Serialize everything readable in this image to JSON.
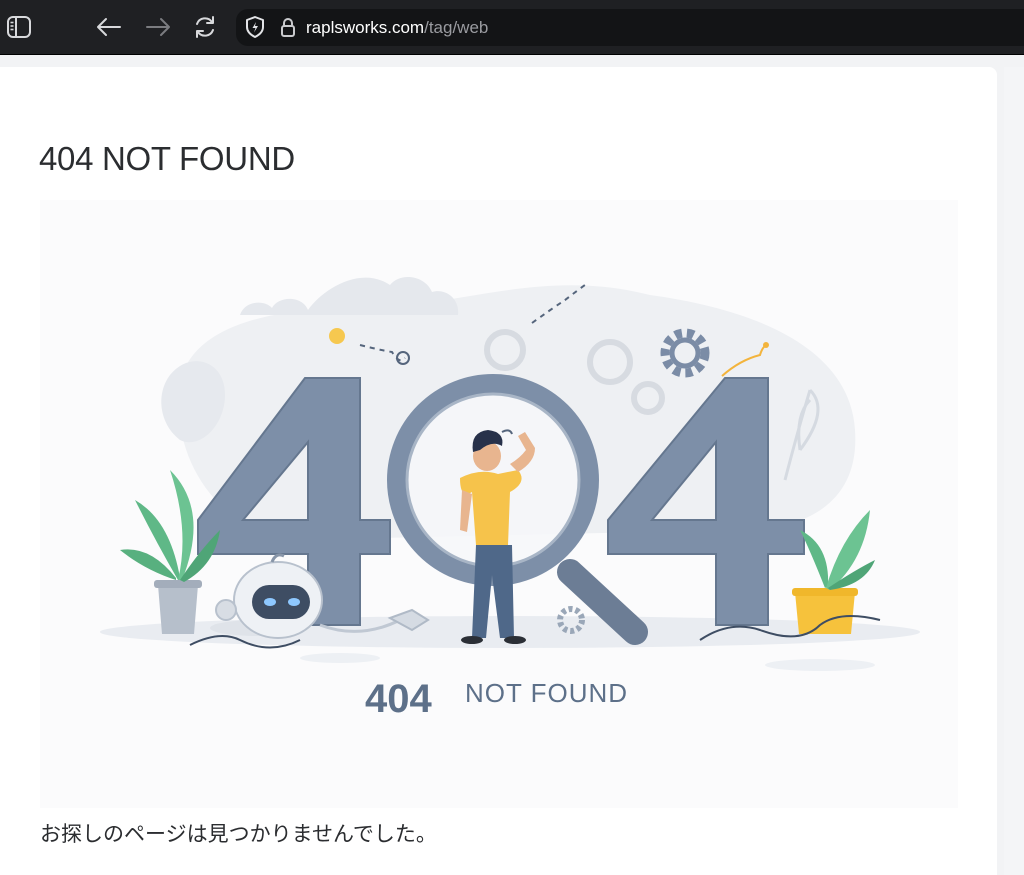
{
  "browser": {
    "url_host": "raplsworks.com",
    "url_path": "/tag/web",
    "icons": {
      "sidebar": "sidebar-icon",
      "back": "back-arrow-icon",
      "forward": "forward-arrow-icon",
      "reload": "reload-icon",
      "privacy": "shield-icon",
      "secure": "lock-icon"
    }
  },
  "page": {
    "title": "404 NOT FOUND",
    "illustration": {
      "number_label": "404",
      "caption_label": "NOT FOUND"
    },
    "message": "お探しのページは見つかりませんでした。"
  },
  "colors": {
    "toolbar_bg": "#1f2023",
    "digit_fill": "#7d8fa8",
    "caption": "#5d7089",
    "shirt": "#f6c34b",
    "leaf": "#5fb887"
  }
}
